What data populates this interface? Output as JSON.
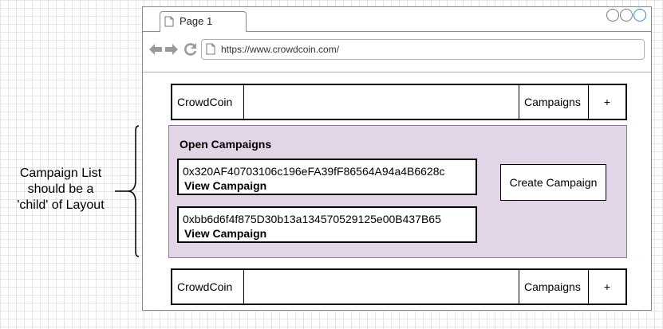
{
  "annotation": {
    "line1": "Campaign List",
    "line2": "should be a",
    "line3": "'child' of Layout"
  },
  "browser": {
    "tab_title": "Page 1",
    "url": "https://www.crowdcoin.com/",
    "icons": [
      "page-icon",
      "back-arrow-icon",
      "forward-arrow-icon",
      "reload-icon",
      "window-control-icon"
    ]
  },
  "header": {
    "brand": "CrowdCoin",
    "campaigns": "Campaigns",
    "plus": "+"
  },
  "campaign_list": {
    "title": "Open Campaigns",
    "items": [
      {
        "address": "0x320AF40703106c196eFA39fF86564A94a4B6628c",
        "link": "View Campaign"
      },
      {
        "address": "0xbb6d6f4f875D30b13a134570529125e00B437B65",
        "link": "View Campaign"
      }
    ],
    "create_button": "Create Campaign"
  },
  "footer": {
    "brand": "CrowdCoin",
    "campaigns": "Campaigns",
    "plus": "+"
  },
  "colors": {
    "list_background": "#e1d5e7",
    "list_border": "#9673a6",
    "window_accent": "#2a8fd6"
  }
}
